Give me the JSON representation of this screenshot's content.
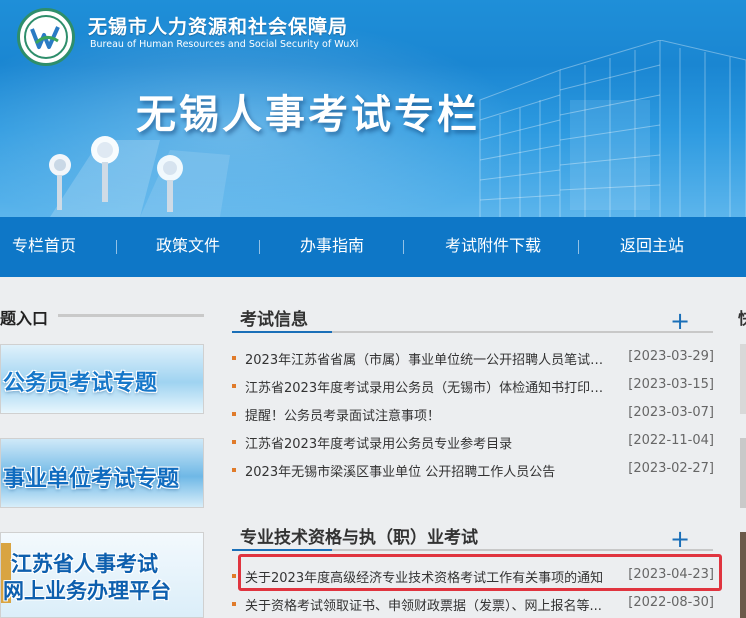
{
  "header": {
    "org_name_cn": "无锡市人力资源和社会保障局",
    "org_name_en": "Bureau of Human Resources and Social Security of WuXi",
    "banner_title": "无锡人事考试专栏"
  },
  "nav": {
    "items": [
      "专栏首页",
      "政策文件",
      "办事指南",
      "考试附件下载",
      "返回主站"
    ]
  },
  "left": {
    "section_title": "题入口",
    "promos": [
      {
        "text": "公务员考试专题"
      },
      {
        "text": "事业单位考试专题"
      },
      {
        "line1": "江苏省人事考试",
        "line2": "网上业务办理平台"
      }
    ]
  },
  "exam_info": {
    "title": "考试信息",
    "more": "+",
    "items": [
      {
        "title": "2023年江苏省省属（市属）事业单位统一公开招聘人员笔试 ...",
        "date": "[2023-03-29]"
      },
      {
        "title": "江苏省2023年度考试录用公务员（无锡市）体检通知书打印入...",
        "date": "[2023-03-15]"
      },
      {
        "title": "提醒！公务员考录面试注意事项！",
        "date": "[2023-03-07]"
      },
      {
        "title": "江苏省2023年度考试录用公务员专业参考目录",
        "date": "[2022-11-04]"
      },
      {
        "title": "2023年无锡市梁溪区事业单位 公开招聘工作人员公告",
        "date": "[2023-02-27]"
      }
    ]
  },
  "qualification": {
    "title": "专业技术资格与执（职）业考试",
    "more": "+",
    "items": [
      {
        "title": "关于2023年度高级经济专业技术资格考试工作有关事项的通知",
        "date": "[2023-04-23]"
      },
      {
        "title": "关于资格考试领取证书、申领财政票据（发票）、网上报名等...",
        "date": "[2022-08-30]"
      }
    ]
  },
  "right": {
    "section_title": "快"
  },
  "colors": {
    "nav_bg": "#0e77c7",
    "accent_blue": "#1a6fb8",
    "bullet_orange": "#e07b2a",
    "highlight_red": "#e0343f"
  }
}
